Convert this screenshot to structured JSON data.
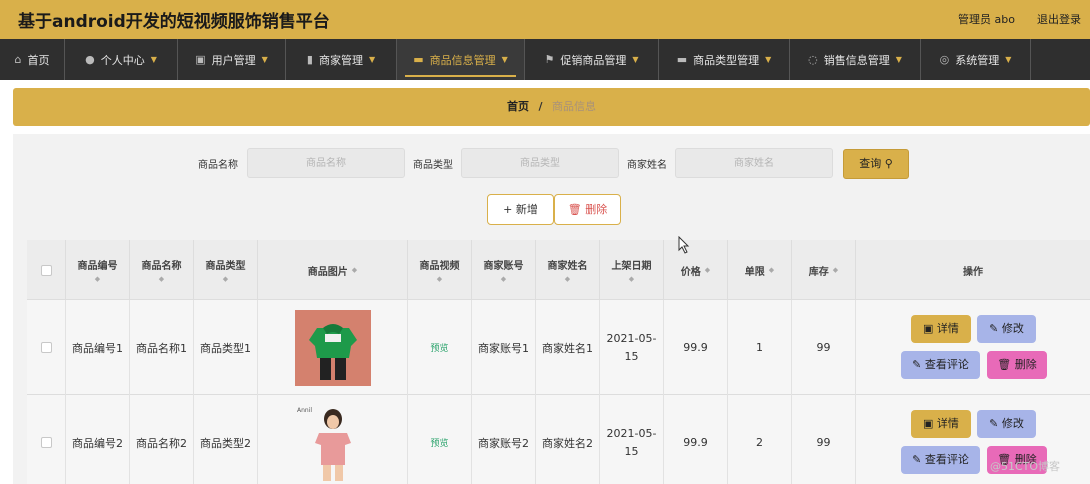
{
  "app": {
    "title": "基于android开发的短视频服饰销售平台",
    "admin": "管理员 abo",
    "logout": "退出登录"
  },
  "nav": [
    {
      "label": "首页",
      "icon": "home-icon",
      "glyph": "⌂"
    },
    {
      "label": "个人中心",
      "icon": "user-icon",
      "glyph": "●"
    },
    {
      "label": "用户管理",
      "icon": "user-manage-icon",
      "glyph": "▣"
    },
    {
      "label": "商家管理",
      "icon": "bar-chart-icon",
      "glyph": "▮"
    },
    {
      "label": "商品信息管理",
      "icon": "goods-icon",
      "glyph": "▬"
    },
    {
      "label": "促销商品管理",
      "icon": "flag-icon",
      "glyph": "⚑"
    },
    {
      "label": "商品类型管理",
      "icon": "card-icon",
      "glyph": "▬"
    },
    {
      "label": "销售信息管理",
      "icon": "power-icon",
      "glyph": "◌"
    },
    {
      "label": "系统管理",
      "icon": "settings-icon",
      "glyph": "◎"
    }
  ],
  "breadcrumb": {
    "home": "首页",
    "separator": "/",
    "current": "商品信息"
  },
  "search": {
    "name_label": "商品名称",
    "name_placeholder": "商品名称",
    "type_label": "商品类型",
    "type_placeholder": "商品类型",
    "merchant_label": "商家姓名",
    "merchant_placeholder": "商家姓名",
    "query_label": "查询 ⚲"
  },
  "actions": {
    "add_label": "+ 新增",
    "delete_label": "🗑 删除"
  },
  "table": {
    "headers": {
      "code": "商品编号",
      "name": "商品名称",
      "type": "商品类型",
      "image": "商品图片",
      "video": "商品视频",
      "account": "商家账号",
      "merchant": "商家姓名",
      "date": "上架日期",
      "price": "价格",
      "limit": "单限",
      "stock": "库存",
      "ops": "操作"
    },
    "sort_glyph": "◆",
    "rows": [
      {
        "code": "商品编号1",
        "name": "商品名称1",
        "type": "商品类型1",
        "video": "预览",
        "account": "商家账号1",
        "merchant": "商家姓名1",
        "date": "2021-05-15",
        "price": "99.9",
        "limit": "1",
        "stock": "99"
      },
      {
        "code": "商品编号2",
        "name": "商品名称2",
        "type": "商品类型2",
        "video": "预览",
        "account": "商家账号2",
        "merchant": "商家姓名2",
        "date": "2021-05-15",
        "price": "99.9",
        "limit": "2",
        "stock": "99"
      }
    ],
    "op_labels": {
      "detail": "▣ 详情",
      "edit": "✎ 修改",
      "comment": "✎ 查看评论",
      "remove": "🗑 删除"
    }
  },
  "image_tags": {
    "row2_brand": "Annil"
  },
  "watermark": "@51CTO博客",
  "colors": {
    "brand": "#d9b04a",
    "nav_bg": "#2f2f2f",
    "edit": "#a7b4e8",
    "remove": "#e86ab8",
    "video": "#2aa36b"
  }
}
